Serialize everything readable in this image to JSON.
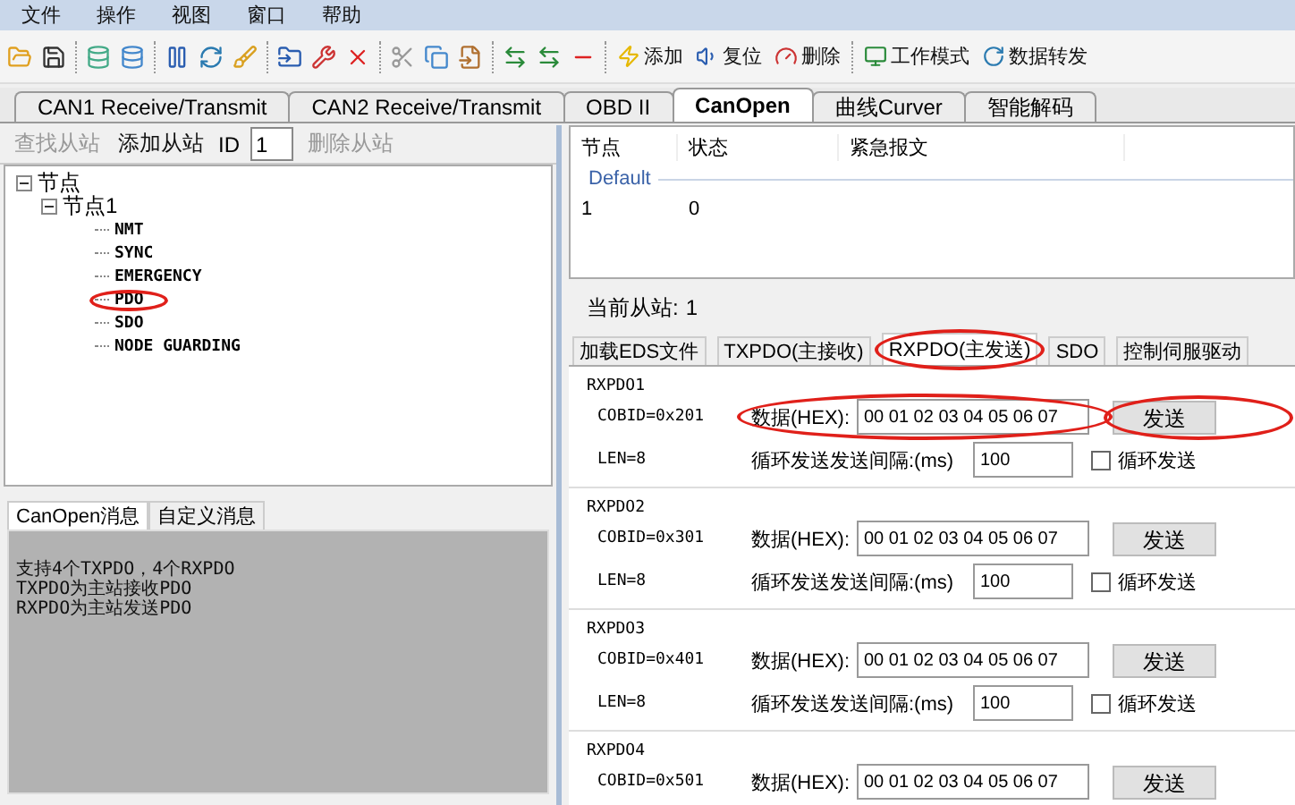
{
  "menu": [
    "文件",
    "操作",
    "视图",
    "窗口",
    "帮助"
  ],
  "toolbar": {
    "buttons": [
      {
        "kind": "flash",
        "label": "添加"
      },
      {
        "kind": "reset",
        "label": "复位"
      },
      {
        "kind": "delete",
        "label": "删除"
      },
      {
        "kind": "mode",
        "label": "工作模式"
      },
      {
        "kind": "forward",
        "label": "数据转发"
      }
    ]
  },
  "main_tabs": [
    {
      "label": "CAN1 Receive/Transmit",
      "selected": false
    },
    {
      "label": "CAN2 Receive/Transmit",
      "selected": false
    },
    {
      "label": "OBD II",
      "selected": false
    },
    {
      "label": "CanOpen",
      "selected": true
    },
    {
      "label": "曲线Curver",
      "selected": false
    },
    {
      "label": "智能解码",
      "selected": false
    }
  ],
  "slave_toolbar": {
    "find": {
      "label": "查找从站",
      "disabled": true
    },
    "add": {
      "label": "添加从站",
      "disabled": false
    },
    "id_label": "ID",
    "id_value": "1",
    "delete": {
      "label": "删除从站",
      "disabled": true
    }
  },
  "tree": [
    {
      "label": "节点",
      "expanded": true,
      "children": [
        {
          "label": "节点1",
          "expanded": true,
          "children": [
            {
              "label": "NMT",
              "highlighted": false
            },
            {
              "label": "SYNC",
              "highlighted": false
            },
            {
              "label": "EMERGENCY",
              "highlighted": false
            },
            {
              "label": "PDO",
              "highlighted": true
            },
            {
              "label": "SDO",
              "highlighted": false
            },
            {
              "label": "NODE GUARDING",
              "highlighted": false
            }
          ]
        }
      ]
    }
  ],
  "message_tabs": [
    {
      "label": "CanOpen消息",
      "selected": true
    },
    {
      "label": "自定义消息",
      "selected": false
    }
  ],
  "message_lines": [
    "支持4个TXPDO，4个RXPDO",
    "TXPDO为主站接收PDO",
    "RXPDO为主站发送PDO"
  ],
  "node_table": {
    "columns": [
      "节点",
      "状态",
      "紧急报文"
    ],
    "group": "Default",
    "rows": [
      [
        "1",
        "0"
      ]
    ]
  },
  "current_slave": {
    "label": "当前从站:",
    "value": "1"
  },
  "pdo_tabs": [
    {
      "label": "加载EDS文件",
      "selected": false,
      "highlighted": false
    },
    {
      "label": "TXPDO(主接收)",
      "selected": false,
      "highlighted": false
    },
    {
      "label": "RXPDO(主发送)",
      "selected": true,
      "highlighted": true
    },
    {
      "label": "SDO",
      "selected": false,
      "highlighted": false
    },
    {
      "label": "控制伺服驱动",
      "selected": false,
      "highlighted": false
    }
  ],
  "rxpdo_groups": [
    {
      "title": "RXPDO1",
      "cobid": "COBID=0x201",
      "data_label": "数据(HEX):",
      "data": "00 01 02 03 04 05 06 07",
      "send": "发送",
      "len": "LEN=8",
      "interval_label": "循环发送发送间隔:(ms)",
      "interval": "100",
      "cyclic_label": "循环发送",
      "cyclic": false,
      "highlighted": true
    },
    {
      "title": "RXPDO2",
      "cobid": "COBID=0x301",
      "data_label": "数据(HEX):",
      "data": "00 01 02 03 04 05 06 07",
      "send": "发送",
      "len": "LEN=8",
      "interval_label": "循环发送发送间隔:(ms)",
      "interval": "100",
      "cyclic_label": "循环发送",
      "cyclic": false,
      "highlighted": false
    },
    {
      "title": "RXPDO3",
      "cobid": "COBID=0x401",
      "data_label": "数据(HEX):",
      "data": "00 01 02 03 04 05 06 07",
      "send": "发送",
      "len": "LEN=8",
      "interval_label": "循环发送发送间隔:(ms)",
      "interval": "100",
      "cyclic_label": "循环发送",
      "cyclic": false,
      "highlighted": false
    },
    {
      "title": "RXPDO4",
      "cobid": "COBID=0x501",
      "data_label": "数据(HEX):",
      "data": "00 01 02 03 04 05 06 07",
      "send": "发送",
      "highlighted": false
    }
  ]
}
